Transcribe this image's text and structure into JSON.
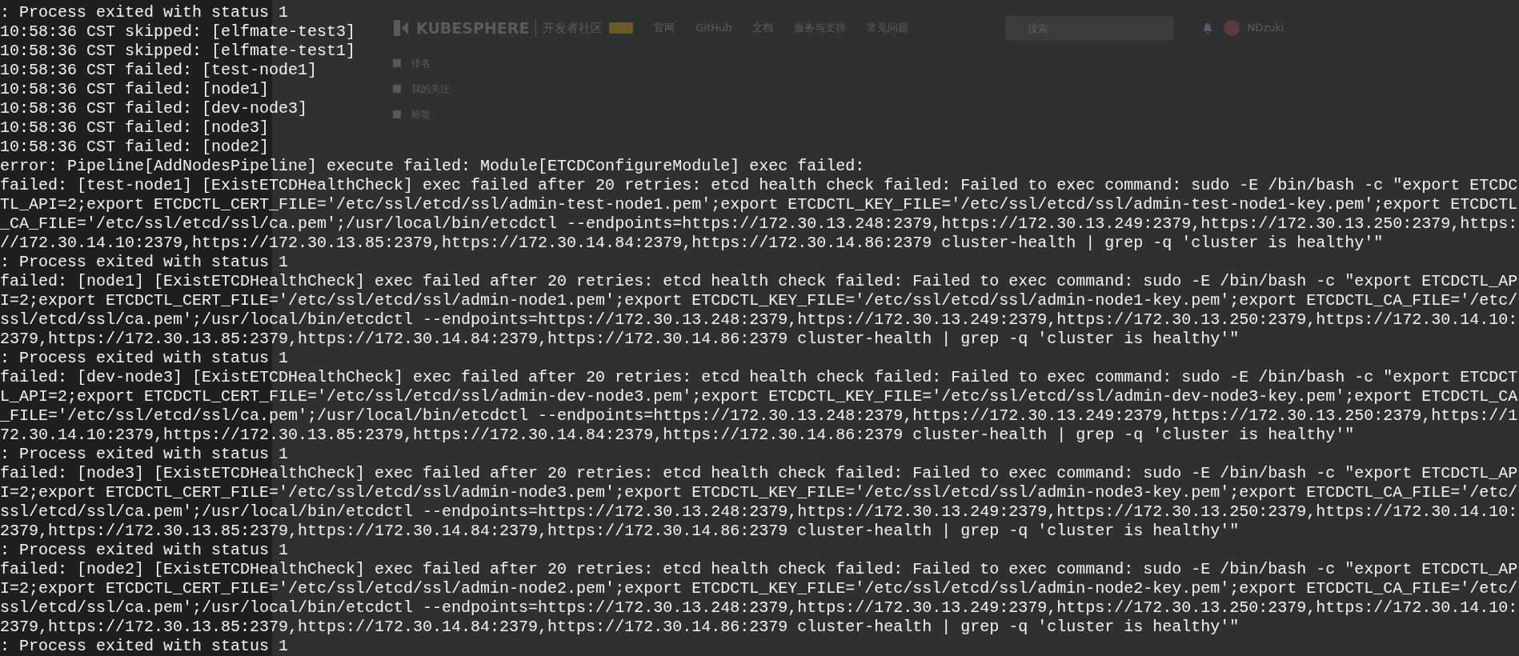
{
  "background_page": {
    "logo": "KUBESPHERE",
    "site_name": "开发者社区",
    "nav": [
      "官网",
      "GitHub",
      "文档",
      "服务与支持",
      "常见问题"
    ],
    "search": {
      "placeholder": "搜索"
    },
    "user": "NDzuki",
    "sidebar": {
      "items": [
        "排名",
        "我的关注",
        "标签"
      ]
    }
  },
  "terminal": {
    "lines": [
      ": Process exited with status 1",
      "10:58:36 CST skipped: [elfmate-test3]",
      "10:58:36 CST skipped: [elfmate-test1]",
      "10:58:36 CST failed: [test-node1]",
      "10:58:36 CST failed: [node1]",
      "10:58:36 CST failed: [dev-node3]",
      "10:58:36 CST failed: [node3]",
      "10:58:36 CST failed: [node2]",
      "error: Pipeline[AddNodesPipeline] execute failed: Module[ETCDConfigureModule] exec failed:",
      "failed: [test-node1] [ExistETCDHealthCheck] exec failed after 20 retries: etcd health check failed: Failed to exec command: sudo -E /bin/bash -c \"export ETCDC",
      "TL_API=2;export ETCDCTL_CERT_FILE='/etc/ssl/etcd/ssl/admin-test-node1.pem';export ETCDCTL_KEY_FILE='/etc/ssl/etcd/ssl/admin-test-node1-key.pem';export ETCDCTL",
      "_CA_FILE='/etc/ssl/etcd/ssl/ca.pem';/usr/local/bin/etcdctl --endpoints=https://172.30.13.248:2379,https://172.30.13.249:2379,https://172.30.13.250:2379,https:",
      "//172.30.14.10:2379,https://172.30.13.85:2379,https://172.30.14.84:2379,https://172.30.14.86:2379 cluster-health | grep -q 'cluster is healthy'\"",
      ": Process exited with status 1",
      "failed: [node1] [ExistETCDHealthCheck] exec failed after 20 retries: etcd health check failed: Failed to exec command: sudo -E /bin/bash -c \"export ETCDCTL_AP",
      "I=2;export ETCDCTL_CERT_FILE='/etc/ssl/etcd/ssl/admin-node1.pem';export ETCDCTL_KEY_FILE='/etc/ssl/etcd/ssl/admin-node1-key.pem';export ETCDCTL_CA_FILE='/etc/",
      "ssl/etcd/ssl/ca.pem';/usr/local/bin/etcdctl --endpoints=https://172.30.13.248:2379,https://172.30.13.249:2379,https://172.30.13.250:2379,https://172.30.14.10:",
      "2379,https://172.30.13.85:2379,https://172.30.14.84:2379,https://172.30.14.86:2379 cluster-health | grep -q 'cluster is healthy'\"",
      ": Process exited with status 1",
      "failed: [dev-node3] [ExistETCDHealthCheck] exec failed after 20 retries: etcd health check failed: Failed to exec command: sudo -E /bin/bash -c \"export ETCDCT",
      "L_API=2;export ETCDCTL_CERT_FILE='/etc/ssl/etcd/ssl/admin-dev-node3.pem';export ETCDCTL_KEY_FILE='/etc/ssl/etcd/ssl/admin-dev-node3-key.pem';export ETCDCTL_CA",
      "_FILE='/etc/ssl/etcd/ssl/ca.pem';/usr/local/bin/etcdctl --endpoints=https://172.30.13.248:2379,https://172.30.13.249:2379,https://172.30.13.250:2379,https://1",
      "72.30.14.10:2379,https://172.30.13.85:2379,https://172.30.14.84:2379,https://172.30.14.86:2379 cluster-health | grep -q 'cluster is healthy'\"",
      ": Process exited with status 1",
      "failed: [node3] [ExistETCDHealthCheck] exec failed after 20 retries: etcd health check failed: Failed to exec command: sudo -E /bin/bash -c \"export ETCDCTL_AP",
      "I=2;export ETCDCTL_CERT_FILE='/etc/ssl/etcd/ssl/admin-node3.pem';export ETCDCTL_KEY_FILE='/etc/ssl/etcd/ssl/admin-node3-key.pem';export ETCDCTL_CA_FILE='/etc/",
      "ssl/etcd/ssl/ca.pem';/usr/local/bin/etcdctl --endpoints=https://172.30.13.248:2379,https://172.30.13.249:2379,https://172.30.13.250:2379,https://172.30.14.10:",
      "2379,https://172.30.13.85:2379,https://172.30.14.84:2379,https://172.30.14.86:2379 cluster-health | grep -q 'cluster is healthy'\"",
      ": Process exited with status 1",
      "failed: [node2] [ExistETCDHealthCheck] exec failed after 20 retries: etcd health check failed: Failed to exec command: sudo -E /bin/bash -c \"export ETCDCTL_AP",
      "I=2;export ETCDCTL_CERT_FILE='/etc/ssl/etcd/ssl/admin-node2.pem';export ETCDCTL_KEY_FILE='/etc/ssl/etcd/ssl/admin-node2-key.pem';export ETCDCTL_CA_FILE='/etc/",
      "ssl/etcd/ssl/ca.pem';/usr/local/bin/etcdctl --endpoints=https://172.30.13.248:2379,https://172.30.13.249:2379,https://172.30.13.250:2379,https://172.30.14.10:",
      "2379,https://172.30.13.85:2379,https://172.30.14.84:2379,https://172.30.14.86:2379 cluster-health | grep -q 'cluster is healthy'\"",
      ": Process exited with status 1"
    ]
  }
}
